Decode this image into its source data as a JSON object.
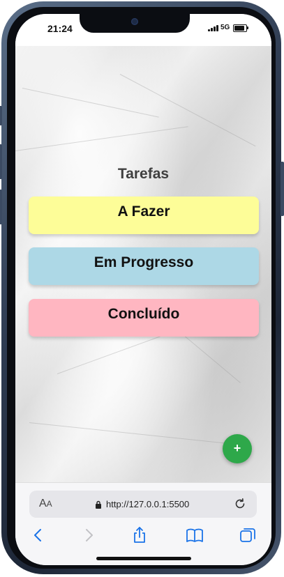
{
  "status_bar": {
    "time": "21:24",
    "network": "5G",
    "battery_level": 0.85
  },
  "page": {
    "title": "Tarefas",
    "columns": [
      {
        "label": "A Fazer",
        "color": "#fdfd98"
      },
      {
        "label": "Em Progresso",
        "color": "#add8e6"
      },
      {
        "label": "Concluído",
        "color": "#ffb6c1"
      }
    ],
    "fab_label": "+",
    "fab_color": "#2ea84a"
  },
  "browser": {
    "text_size_label_big": "A",
    "text_size_label_small": "A",
    "url": "http://127.0.0.1:5500",
    "accent_color": "#1a73e8",
    "icons": [
      "back-icon",
      "forward-icon",
      "share-icon",
      "bookmarks-icon",
      "tabs-icon",
      "reload-icon",
      "lock-icon"
    ]
  }
}
